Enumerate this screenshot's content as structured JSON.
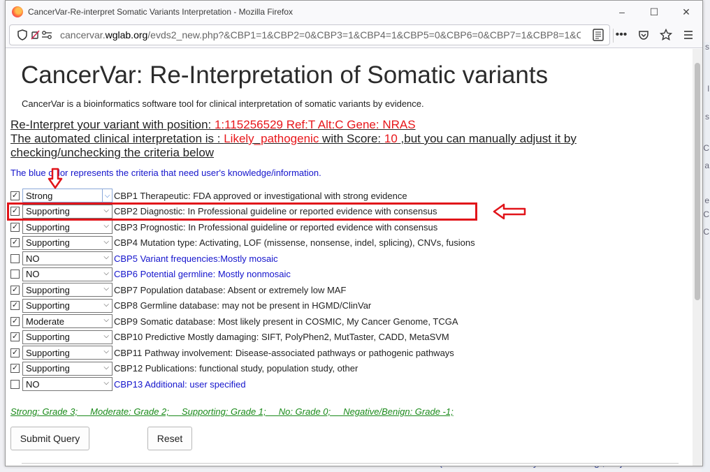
{
  "window": {
    "title": "CancerVar-Re-interpret Somatic Variants Interpretation - Mozilla Firefox",
    "controls": {
      "minimize": "–",
      "maximize": "☐",
      "close": "✕"
    }
  },
  "navbar": {
    "url_prefix": "cancervar.",
    "url_domain": "wglab.org",
    "url_rest": "/evds2_new.php?&CBP1=1&CBP2=0&CBP3=1&CBP4=1&CBP5=0&CBP6=0&CBP7=1&CBP8=1&CB",
    "icons": [
      "shield-icon",
      "permissions-icon",
      "reader-view-icon",
      "overflow-icon",
      "pocket-icon",
      "bookmark-star-icon",
      "menu-icon"
    ]
  },
  "page": {
    "title": "CancerVar: Re-Interpretation of Somatic variants",
    "description": "CancerVar is a bioinformatics software tool for clinical interpretation of somatic variants by evidence.",
    "position_label": "Re-Interpret your variant with position: ",
    "position_value": "1:115256529 Ref:T Alt:C Gene: NRAS",
    "interp_label": "The automated clinical interpretation is : ",
    "interp_value": "Likely_pathogenic",
    "score_label": " with Score: ",
    "score_value": "10 ",
    "adjust_text": ",but you can manually adjust it by",
    "adjust_text2": "checking/unchecking the criteria below",
    "blue_note": "The blue color represents the criteria that need user's knowledge/information."
  },
  "criteria": [
    {
      "checked": true,
      "level": "Strong",
      "text": "CBP1 Therapeutic: FDA approved or investigational with strong evidence",
      "blue": false
    },
    {
      "checked": true,
      "level": "Supporting",
      "text": "CBP2 Diagnostic: In Professional guideline or reported evidence with consensus",
      "blue": false
    },
    {
      "checked": true,
      "level": "Supporting",
      "text": "CBP3 Prognostic: In Professional guideline or reported evidence with consensus",
      "blue": false
    },
    {
      "checked": true,
      "level": "Supporting",
      "text": "CBP4 Mutation type: Activating, LOF (missense, nonsense, indel, splicing), CNVs, fusions",
      "blue": false
    },
    {
      "checked": false,
      "level": "NO",
      "text": "CBP5 Variant frequencies:Mostly mosaic",
      "blue": true
    },
    {
      "checked": false,
      "level": "NO",
      "text": "CBP6 Potential germline: Mostly nonmosaic",
      "blue": true
    },
    {
      "checked": true,
      "level": "Supporting",
      "text": "CBP7 Population database: Absent or extremely low MAF",
      "blue": false
    },
    {
      "checked": true,
      "level": "Supporting",
      "text": "CBP8 Germline database: may not be present in HGMD/ClinVar",
      "blue": false
    },
    {
      "checked": true,
      "level": "Moderate",
      "text": "CBP9 Somatic database: Most likely present in COSMIC, My Cancer Genome, TCGA",
      "blue": false
    },
    {
      "checked": true,
      "level": "Supporting",
      "text": "CBP10 Predictive Mostly damaging: SIFT, PolyPhen2, MutTaster, CADD, MetaSVM",
      "blue": false
    },
    {
      "checked": true,
      "level": "Supporting",
      "text": "CBP11 Pathway involvement: Disease-associated pathways or pathogenic pathways",
      "blue": false
    },
    {
      "checked": true,
      "level": "Supporting",
      "text": "CBP12 Publications: functional study, population study, other",
      "blue": false
    },
    {
      "checked": false,
      "level": "NO",
      "text": "CBP13 Additional: user specified",
      "blue": true
    }
  ],
  "legend": "Strong: Grade 3;     Moderate: Grade 2;     Supporting: Grade 1;     No: Grade 0;     Negative/Benign: Grade -1;",
  "buttons": {
    "submit": "Submit Query",
    "reset": "Reset"
  },
  "background": {
    "bottom_text": "GLRP + RS(Genomic Evolutionary Rate Profiling ; Rejected Substitutions)",
    "side_letters": [
      "s",
      "l",
      "s",
      "C",
      "a",
      "e",
      "C",
      "C"
    ]
  },
  "colors": {
    "accent_red": "#e8161a",
    "note_blue": "#1414cc",
    "legend_green": "#1a8a1a"
  }
}
